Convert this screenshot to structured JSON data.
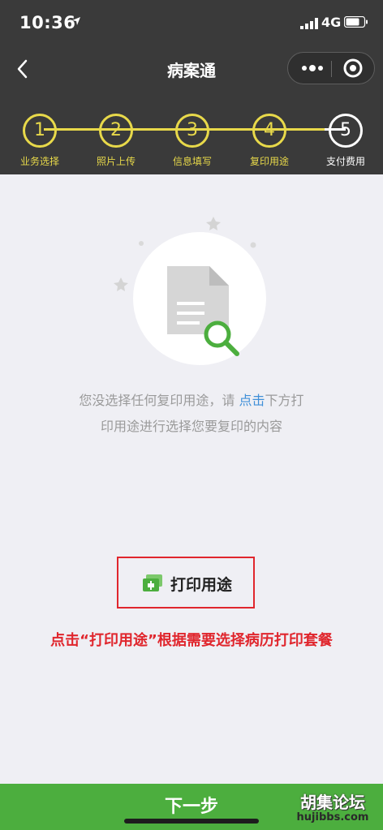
{
  "status_bar": {
    "time": "10:36",
    "network": "4G"
  },
  "navbar": {
    "title": "病案通"
  },
  "steps": [
    {
      "number": "1",
      "label": "业务选择"
    },
    {
      "number": "2",
      "label": "照片上传"
    },
    {
      "number": "3",
      "label": "信息填写"
    },
    {
      "number": "4",
      "label": "复印用途"
    },
    {
      "number": "5",
      "label": "支付费用"
    }
  ],
  "empty_state": {
    "line1_part1": "您没选择任何复印用途，请",
    "link": "点击",
    "line1_part2": "下方打",
    "line2": "印用途进行选择您要复印的内容"
  },
  "print_button": {
    "label": "打印用途"
  },
  "instruction": "点击“打印用途”根据需要选择病历打印套餐",
  "bottom": {
    "next_label": "下一步"
  },
  "watermark": {
    "cn": "胡集论坛",
    "en": "hujibbs.com"
  },
  "colors": {
    "header_bg": "#3a3a3a",
    "step_accent": "#e8d94a",
    "link": "#3f8fd8",
    "highlight_red": "#e0262d",
    "primary_green": "#4cae3e"
  },
  "icons": {
    "location": "location-arrow-icon",
    "signal": "signal-bars-icon",
    "battery": "battery-icon",
    "back": "chevron-left-icon",
    "more": "more-dots-icon",
    "close": "target-circle-icon",
    "document": "document-search-icon",
    "print": "print-folder-icon"
  }
}
